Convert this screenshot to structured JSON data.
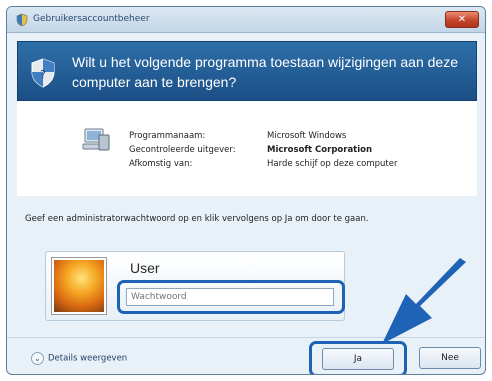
{
  "window": {
    "title": "Gebruikersaccountbeheer",
    "close_glyph": "✕"
  },
  "banner": {
    "message": "Wilt u het volgende programma toestaan wijzigingen aan deze computer aan te brengen?"
  },
  "program": {
    "rows": [
      {
        "label": "Programmanaam:",
        "value": "Microsoft Windows",
        "bold": false
      },
      {
        "label": "Gecontroleerde uitgever:",
        "value": "Microsoft Corporation",
        "bold": true
      },
      {
        "label": "Afkomstig van:",
        "value": "Harde schijf op deze computer",
        "bold": false
      }
    ]
  },
  "instruction": "Geef een administratorwachtwoord op en klik vervolgens op Ja om door te gaan.",
  "credentials": {
    "username": "User",
    "password_placeholder": "Wachtwoord"
  },
  "footer": {
    "details_label": "Details weergeven",
    "yes_label": "Ja",
    "no_label": "Nee"
  },
  "colors": {
    "banner": "#1f5a93",
    "highlight": "#1e62b5",
    "close": "#c4452b"
  }
}
